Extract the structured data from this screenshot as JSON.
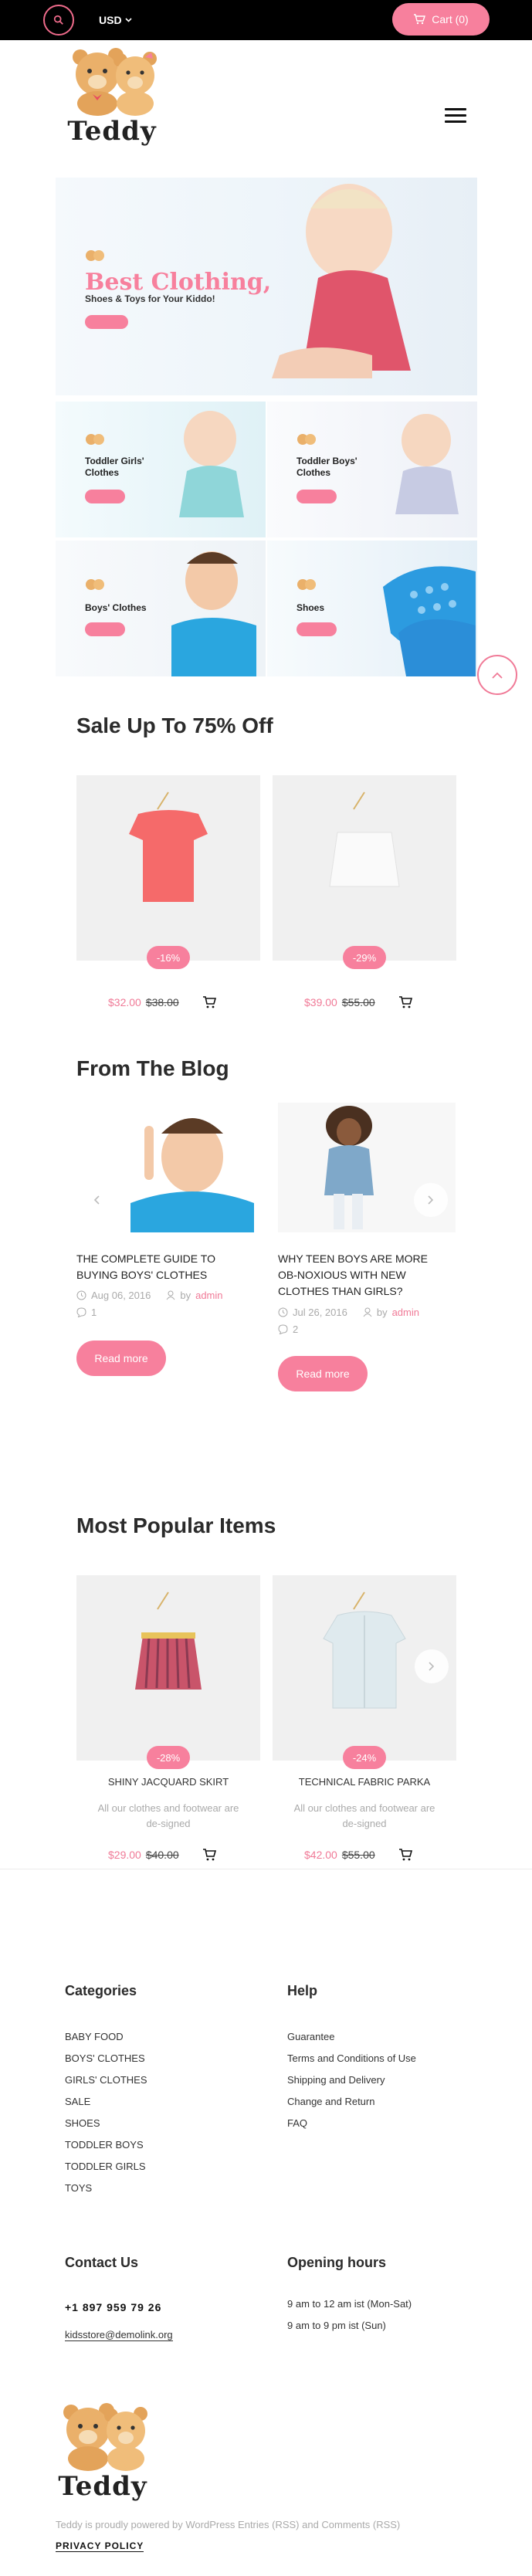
{
  "topbar": {
    "currency": "USD",
    "cart_label": "Cart (0)"
  },
  "brand": {
    "name": "Teddy"
  },
  "banners": {
    "hero": {
      "title": "Best Clothing,",
      "subtitle": "Shoes & Toys for Your Kiddo!"
    },
    "small": [
      {
        "title": "Toddler Girls' Clothes"
      },
      {
        "title": "Toddler Boys' Clothes"
      },
      {
        "title": "Boys' Clothes"
      },
      {
        "title": "Shoes"
      }
    ]
  },
  "sale": {
    "heading": "Sale Up To 75% Off",
    "products": [
      {
        "badge": "-16%",
        "price": "$32.00",
        "old_price": "$38.00"
      },
      {
        "badge": "-29%",
        "price": "$39.00",
        "old_price": "$55.00"
      }
    ]
  },
  "blog": {
    "heading": "From The Blog",
    "posts": [
      {
        "title": "THE COMPLETE GUIDE TO BUYING BOYS' CLOTHES",
        "date": "Aug 06, 2016",
        "author_prefix": "by",
        "author": "admin",
        "comments": "1",
        "read_more": "Read more"
      },
      {
        "title": "WHY TEEN BOYS ARE MORE OB-NOXIOUS WITH NEW CLOTHES THAN GIRLS?",
        "date": "Jul 26, 2016",
        "author_prefix": "by",
        "author": "admin",
        "comments": "2",
        "read_more": "Read more"
      }
    ]
  },
  "popular": {
    "heading": "Most Popular Items",
    "products": [
      {
        "badge": "-28%",
        "name": "SHINY JACQUARD SKIRT",
        "desc": "All our clothes and footwear are de-signed",
        "price": "$29.00",
        "old_price": "$40.00"
      },
      {
        "badge": "-24%",
        "name": "TECHNICAL FABRIC PARKA",
        "desc": "All our clothes and footwear are de-signed",
        "price": "$42.00",
        "old_price": "$55.00"
      }
    ]
  },
  "footer": {
    "categories": {
      "heading": "Categories",
      "items": [
        "BABY FOOD",
        "BOYS' CLOTHES",
        "GIRLS' CLOTHES",
        "SALE",
        "SHOES",
        "TODDLER BOYS",
        "TODDLER GIRLS",
        "TOYS"
      ]
    },
    "help": {
      "heading": "Help",
      "items": [
        "Guarantee",
        "Terms and Conditions of Use",
        "Shipping and Delivery",
        "Change and Return",
        "FAQ"
      ]
    },
    "contact": {
      "heading": "Contact Us",
      "phone": "+1 897 959 79 26",
      "email": "kidsstore@demolink.org"
    },
    "hours": {
      "heading": "Opening hours",
      "line1": "9 am to 12 am ist (Mon-Sat)",
      "line2": "9 am to 9 pm ist (Sun)"
    },
    "powered": "Teddy is proudly powered by WordPress Entries (RSS) and Comments (RSS)",
    "privacy": "PRIVACY POLICY"
  },
  "colors": {
    "accent": "#f7809d",
    "topbar": "#000000"
  }
}
